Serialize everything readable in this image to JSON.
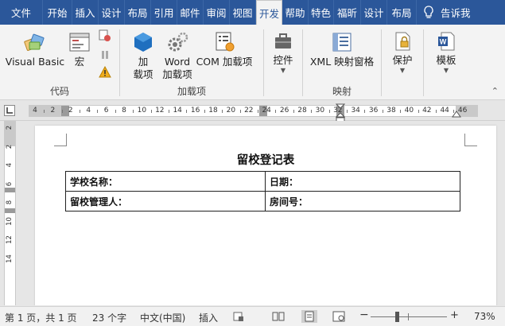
{
  "tabs": [
    {
      "label": "文件",
      "active": false
    },
    {
      "label": "开始",
      "active": false
    },
    {
      "label": "插入",
      "active": false
    },
    {
      "label": "设计",
      "active": false
    },
    {
      "label": "布局",
      "active": false
    },
    {
      "label": "引用",
      "active": false
    },
    {
      "label": "邮件",
      "active": false
    },
    {
      "label": "审阅",
      "active": false
    },
    {
      "label": "视图",
      "active": false
    },
    {
      "label": "开发",
      "active": true
    },
    {
      "label": "帮助",
      "active": false
    },
    {
      "label": "特色",
      "active": false
    },
    {
      "label": "福昕",
      "active": false
    },
    {
      "label": "设计",
      "active": false
    },
    {
      "label": "布局",
      "active": false
    },
    {
      "label": "告诉我",
      "active": false
    }
  ],
  "ribbon": {
    "code_group": {
      "label": "代码",
      "visual_basic": "Visual Basic",
      "macro": "宏"
    },
    "addins_group": {
      "label": "加载项",
      "addins": "加\n载项",
      "addins_l1": "加",
      "addins_l2": "载项",
      "word_addins_l1": "Word",
      "word_addins_l2": "加载项",
      "com_addins": "COM 加载项"
    },
    "controls_group": {
      "label": "控件"
    },
    "mapping_group": {
      "label": "映射",
      "xml_mapping": "XML 映射窗格"
    },
    "protect_group": {
      "label": "保护"
    },
    "templates_group": {
      "label": "模板"
    }
  },
  "ruler": {
    "h_numbers": [
      "4",
      "2",
      "2",
      "4",
      "6",
      "8",
      "10",
      "12",
      "14",
      "16",
      "18",
      "20",
      "22",
      "24",
      "26",
      "28",
      "30",
      "32",
      "34",
      "36",
      "38",
      "40",
      "42",
      "44",
      "46"
    ],
    "v_numbers": [
      "2",
      "2",
      "4",
      "6",
      "8",
      "10",
      "12",
      "14"
    ]
  },
  "document": {
    "title": "留校登记表",
    "rows": [
      [
        "学校名称：",
        "日期："
      ],
      [
        "留校管理人：",
        "房间号："
      ]
    ]
  },
  "status": {
    "page": "第 1 页，共 1 页",
    "words": "23 个字",
    "language": "中文(中国)",
    "mode": "插入",
    "zoom_minus": "−",
    "zoom_plus": "+",
    "zoom": "73%",
    "zoom_level": 0.73
  },
  "colors": {
    "accent": "#2b579a",
    "ribbon_bg": "#f3f3f3"
  }
}
